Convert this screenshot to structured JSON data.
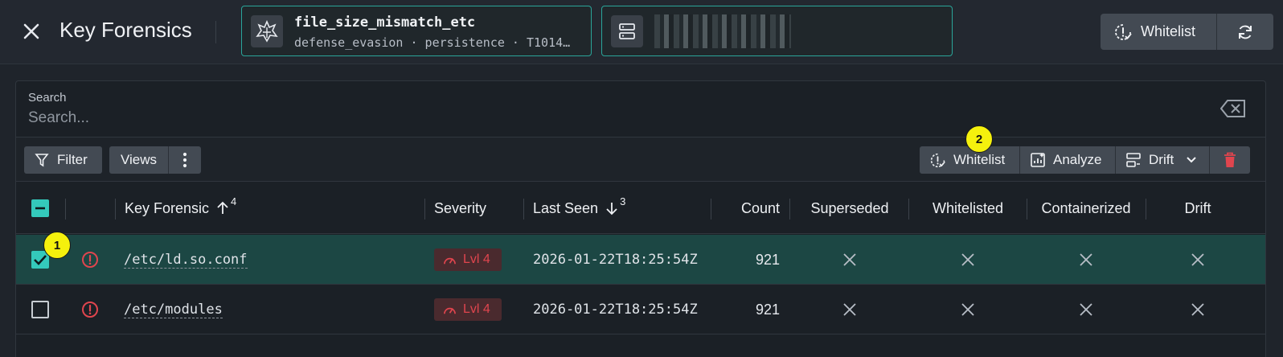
{
  "header": {
    "title": "Key Forensics",
    "rule_card": {
      "title": "file_size_mismatch_etc",
      "subtitle": "defense_evasion · persistence · T1014…"
    },
    "whitelist_label": "Whitelist"
  },
  "search": {
    "label": "Search",
    "placeholder": "Search..."
  },
  "toolbar": {
    "filter_label": "Filter",
    "views_label": "Views",
    "whitelist_label": "Whitelist",
    "analyze_label": "Analyze",
    "drift_label": "Drift"
  },
  "table": {
    "columns": {
      "key_forensic": "Key Forensic",
      "key_forensic_sort": "4",
      "severity": "Severity",
      "last_seen": "Last Seen",
      "last_seen_sort": "3",
      "count": "Count",
      "superseded": "Superseded",
      "whitelisted": "Whitelisted",
      "containerized": "Containerized",
      "drift": "Drift"
    },
    "rows": [
      {
        "path": "/etc/ld.so.conf",
        "severity": "Lvl 4",
        "last_seen": "2026-01-22T18:25:54Z",
        "count": "921",
        "selected": true
      },
      {
        "path": "/etc/modules",
        "severity": "Lvl 4",
        "last_seen": "2026-01-22T18:25:54Z",
        "count": "921",
        "selected": false
      }
    ]
  },
  "markers": {
    "m1": "1",
    "m2": "2"
  },
  "colors": {
    "accent": "#34c9bb",
    "danger": "#e0454e",
    "selected_row": "#1c4744",
    "marker": "#f5f10d"
  }
}
